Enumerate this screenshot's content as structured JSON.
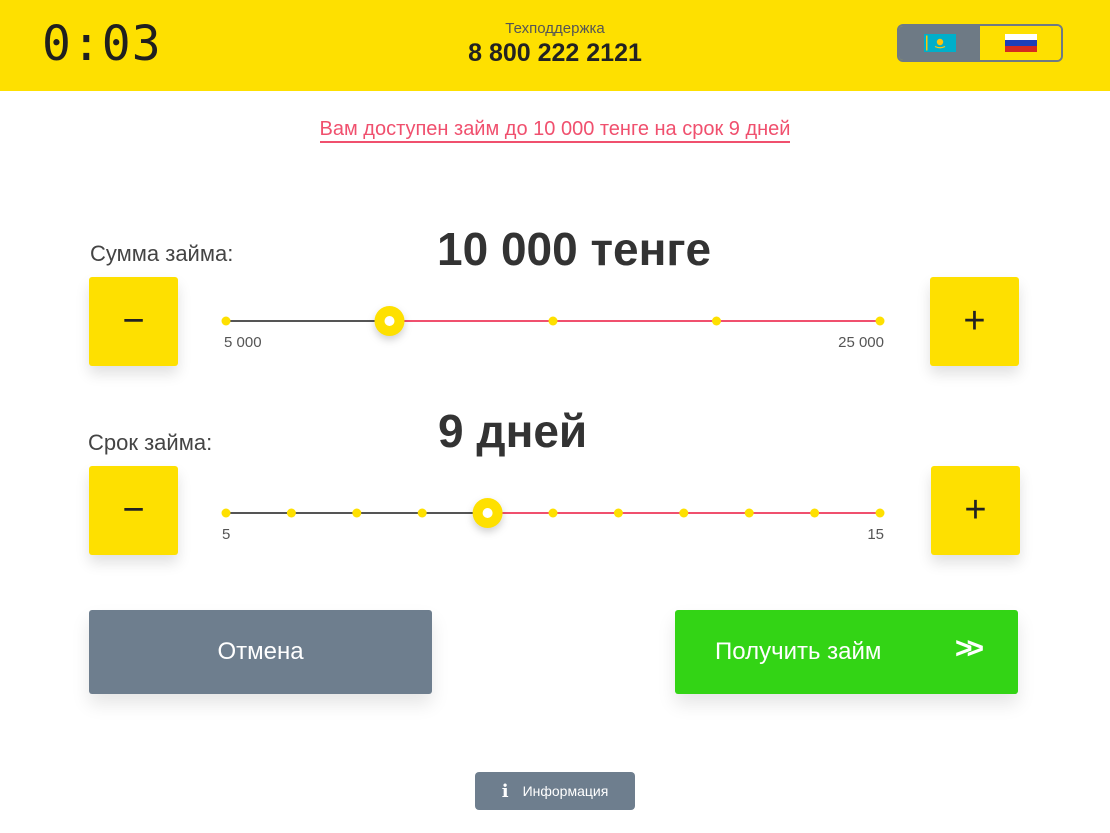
{
  "header": {
    "timer": "0:03",
    "support_label": "Техподдержка",
    "support_phone": "8 800 222 2121",
    "languages": [
      {
        "code": "kz",
        "icon": "kazakhstan-flag-icon",
        "active": true
      },
      {
        "code": "ru",
        "icon": "russia-flag-icon",
        "active": false
      }
    ]
  },
  "offer": "Вам доступен займ до 10 000 тенге на срок 9 дней",
  "amount": {
    "label": "Сумма займа:",
    "value": "10 000 тенге",
    "min_label": "5 000",
    "max_label": "25 000",
    "min": 5000,
    "max": 25000,
    "step": 5000,
    "current": 10000,
    "minus": "−",
    "plus": "+"
  },
  "term": {
    "label": "Срок займа:",
    "value": "9 дней",
    "min_label": "5",
    "max_label": "15",
    "min": 5,
    "max": 15,
    "step": 1,
    "current": 9,
    "minus": "−",
    "plus": "+"
  },
  "buttons": {
    "cancel": "Отмена",
    "get_loan": "Получить займ",
    "get_loan_icon": ">>"
  },
  "info": {
    "label": "Информация",
    "icon": "i"
  },
  "colors": {
    "brand_yellow": "#FEE000",
    "accent_pink": "#f0506e",
    "track_gray": "#555555",
    "cancel_gray": "#6e7e8e",
    "success_green": "#33d415"
  }
}
